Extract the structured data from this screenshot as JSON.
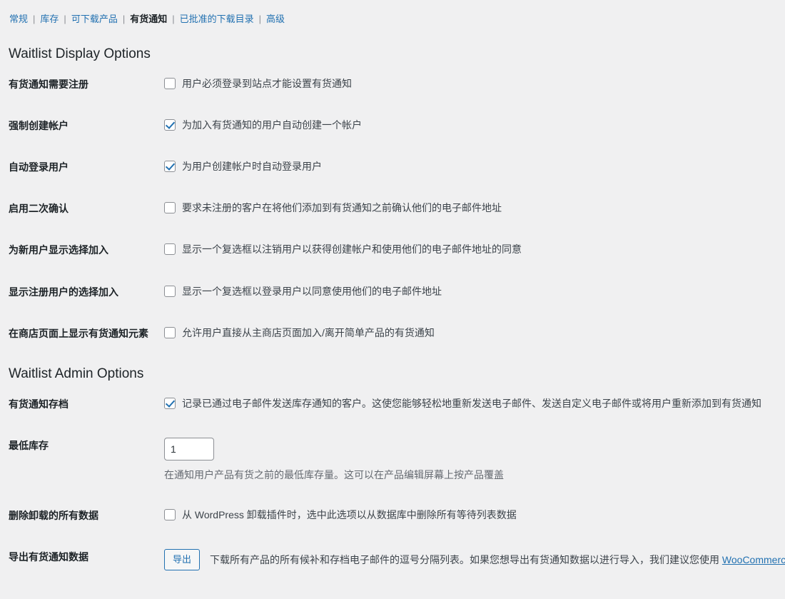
{
  "nav": {
    "tabs": [
      {
        "label": "常规",
        "current": false
      },
      {
        "label": "库存",
        "current": false
      },
      {
        "label": "可下载产品",
        "current": false
      },
      {
        "label": "有货通知",
        "current": true
      },
      {
        "label": "已批准的下载目录",
        "current": false
      },
      {
        "label": "高级",
        "current": false
      }
    ],
    "separator": "|"
  },
  "sections": [
    {
      "title": "Waitlist Display Options",
      "rows": [
        {
          "label": "有货通知需要注册",
          "control": "checkbox",
          "checked": false,
          "text": "用户必须登录到站点才能设置有货通知"
        },
        {
          "label": "强制创建帐户",
          "control": "checkbox",
          "checked": true,
          "text": "为加入有货通知的用户自动创建一个帐户"
        },
        {
          "label": "自动登录用户",
          "control": "checkbox",
          "checked": true,
          "text": "为用户创建帐户时自动登录用户"
        },
        {
          "label": "启用二次确认",
          "control": "checkbox",
          "checked": false,
          "text": "要求未注册的客户在将他们添加到有货通知之前确认他们的电子邮件地址"
        },
        {
          "label": "为新用户显示选择加入",
          "control": "checkbox",
          "checked": false,
          "text": "显示一个复选框以注销用户以获得创建帐户和使用他们的电子邮件地址的同意"
        },
        {
          "label": "显示注册用户的选择加入",
          "control": "checkbox",
          "checked": false,
          "text": "显示一个复选框以登录用户以同意使用他们的电子邮件地址"
        },
        {
          "label": "在商店页面上显示有货通知元素",
          "control": "checkbox",
          "checked": false,
          "text": "允许用户直接从主商店页面加入/离开简单产品的有货通知"
        }
      ]
    },
    {
      "title": "Waitlist Admin Options",
      "rows": [
        {
          "label": "有货通知存档",
          "control": "checkbox",
          "checked": true,
          "text": "记录已通过电子邮件发送库存通知的客户。这使您能够轻松地重新发送电子邮件、发送自定义电子邮件或将用户重新添加到有货通知"
        },
        {
          "label": "最低库存",
          "control": "number",
          "value": "1",
          "description": "在通知用户产品有货之前的最低库存量。这可以在产品编辑屏幕上按产品覆盖"
        },
        {
          "label": "删除卸载的所有数据",
          "control": "checkbox",
          "checked": false,
          "text": "从 WordPress 卸载插件时，选中此选项以从数据库中删除所有等待列表数据"
        },
        {
          "label": "导出有货通知数据",
          "control": "button",
          "button_label": "导出",
          "description_before": "下载所有产品的所有候补和存档电子邮件的逗号分隔列表。如果您想导出有货通知数据以进行导入，我们建议您使用 ",
          "description_link": "WooCommerce"
        }
      ]
    }
  ],
  "colors": {
    "link": "#2271b1",
    "background": "#f0f0f1",
    "text": "#3c434a",
    "heading": "#1d2327",
    "muted": "#646970"
  }
}
